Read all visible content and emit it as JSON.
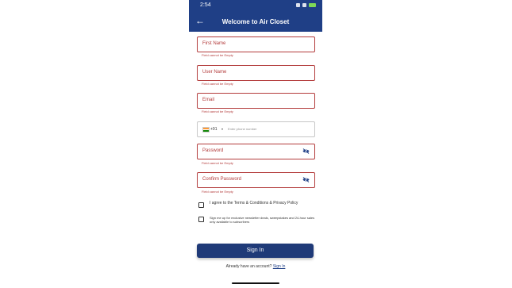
{
  "status_bar": {
    "time": "2:54"
  },
  "app_bar": {
    "title": "Welcome to Air Closet"
  },
  "fields": {
    "first_name": {
      "label": "First Name",
      "error": "Field cannot be Empty"
    },
    "user_name": {
      "label": "User Name",
      "error": "Field cannot be Empty"
    },
    "email": {
      "label": "Email",
      "error": "Field cannot be Empty"
    },
    "phone": {
      "country_code": "+91",
      "placeholder": "Enter phone number"
    },
    "password": {
      "label": "Password",
      "error": "Field cannot be Empty"
    },
    "confirm_password": {
      "label": "Confirm Password",
      "error": "Field cannot be Empty"
    }
  },
  "checkboxes": {
    "terms": {
      "label": "I agree to the Terms & Conditions & Privacy Policy",
      "checked": false
    },
    "newsletter": {
      "label": "Sign me up for exclusive newsletter deals, sweepstakes and 24-hour sales only available to subscribers",
      "checked": false
    }
  },
  "actions": {
    "sign_in_button": "Sign In",
    "account_prompt": "Already have an account?",
    "sign_in_link": "Sign In"
  },
  "colors": {
    "primary": "#1f3f86",
    "error": "#b33b3b"
  }
}
